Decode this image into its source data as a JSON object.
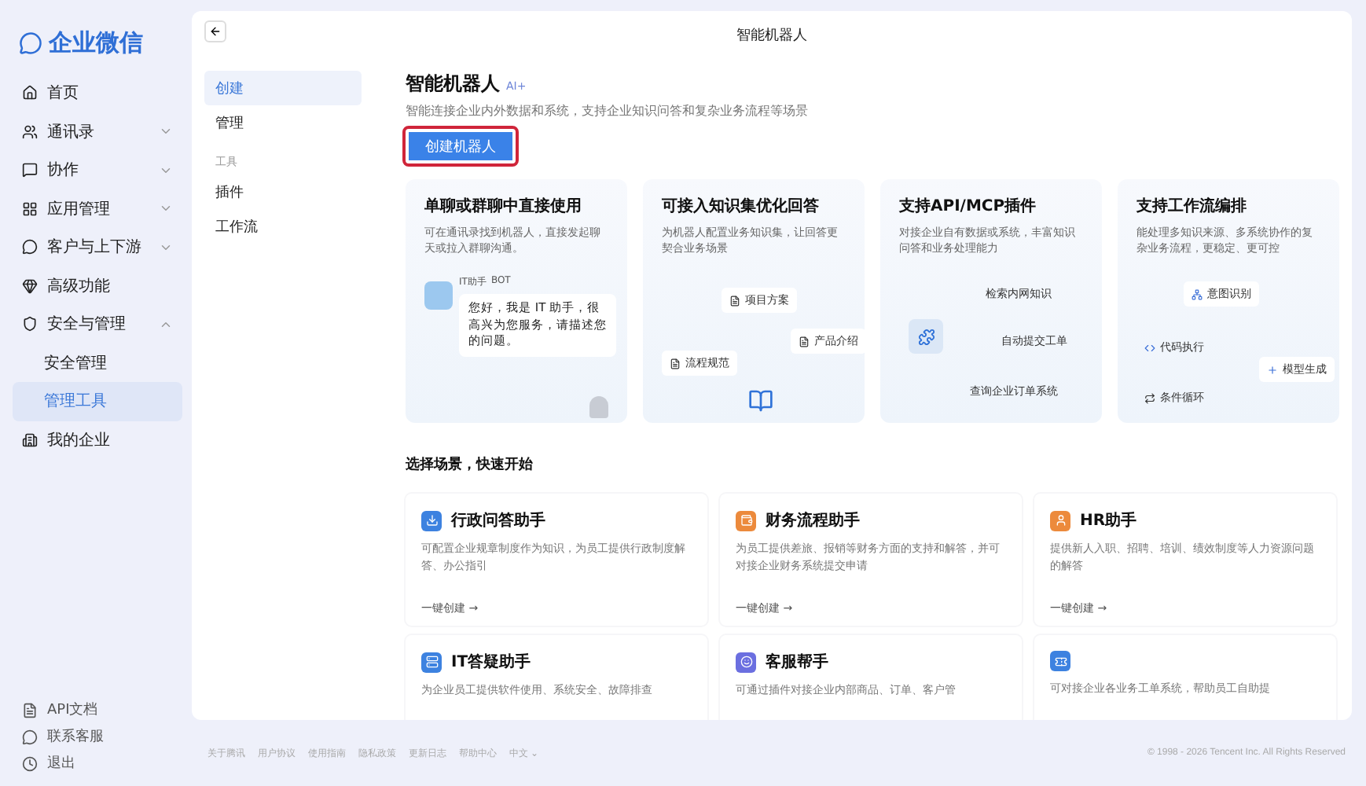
{
  "brand": {
    "name": "企业微信"
  },
  "sidebar": {
    "items": [
      {
        "label": "首页",
        "selected": false
      },
      {
        "label": "通讯录",
        "expanded": false,
        "selected": false
      },
      {
        "label": "协作",
        "expanded": false,
        "selected": false
      },
      {
        "label": "应用管理",
        "expanded": false,
        "selected": false
      },
      {
        "label": "客户与上下游",
        "expanded": false,
        "selected": false
      },
      {
        "label": "高级功能",
        "selected": false
      },
      {
        "label": "安全与管理",
        "expanded": true,
        "selected": false,
        "children": [
          {
            "label": "安全管理",
            "selected": false
          },
          {
            "label": "管理工具",
            "selected": true
          }
        ]
      },
      {
        "label": "我的企业",
        "selected": false
      }
    ],
    "bottom_links": [
      {
        "label": "API文档"
      },
      {
        "label": "联系客服"
      },
      {
        "label": "退出"
      }
    ]
  },
  "header": {
    "title": "智能机器人"
  },
  "subnav": [
    {
      "kind": "item",
      "label": "创建",
      "selected": true
    },
    {
      "kind": "item",
      "label": "管理",
      "selected": false
    },
    {
      "kind": "group",
      "label": "工具"
    },
    {
      "kind": "item",
      "label": "插件",
      "selected": false
    },
    {
      "kind": "item",
      "label": "工作流",
      "selected": false
    }
  ],
  "intro": {
    "title": "智能机器人",
    "badge": "AI+",
    "description": "智能连接企业内外数据和系统，支持企业知识问答和复杂业务流程等场景",
    "button": "创建机器人"
  },
  "features": [
    {
      "kind": "chat",
      "title": "单聊或群聊中直接使用",
      "description": "可在通讯录找到机器人，直接发起聊天或拉入群聊沟通。",
      "bot_name": "IT助手",
      "bot_tag": "BOT",
      "message": "您好，我是 IT 助手，很高兴为您服务，请描述您的问题。"
    },
    {
      "kind": "knowledge",
      "title": "可接入知识集优化回答",
      "description": "为机器人配置业务知识集，让回答更契合业务场景",
      "chips": [
        "项目方案",
        "产品介绍",
        "流程规范"
      ]
    },
    {
      "kind": "plugin",
      "title": "支持API/MCP插件",
      "description": "对接企业自有数据或系统，丰富知识问答和业务处理能力",
      "chips": [
        "检索内网知识",
        "自动提交工单",
        "查询企业订单系统"
      ]
    },
    {
      "kind": "workflow",
      "title": "支持工作流编排",
      "description": "能处理多知识来源、多系统协作的复杂业务流程，更稳定、更可控",
      "chips": [
        "意图识别",
        "代码执行",
        "模型生成",
        "条件循环"
      ]
    }
  ],
  "scenarios": {
    "title": "选择场景，快速开始",
    "cards": [
      {
        "title": "行政问答助手",
        "color": "#3d82e0",
        "description": "可配置企业规章制度作为知识，为员工提供行政制度解答、办公指引",
        "action": "一键创建 →"
      },
      {
        "title": "财务流程助手",
        "color": "#ec8a3c",
        "description": "为员工提供差旅、报销等财务方面的支持和解答，并可对接企业财务系统提交申请",
        "action": "一键创建 →"
      },
      {
        "title": "HR助手",
        "color": "#ec8a3c",
        "description": "提供新人入职、招聘、培训、绩效制度等人力资源问题的解答",
        "action": "一键创建 →"
      },
      {
        "title": "IT答疑助手",
        "color": "#3d82e0",
        "description": "为企业员工提供软件使用、系统安全、故障排查"
      },
      {
        "title": "客服帮手",
        "color": "#6b6fe0",
        "description": "可通过插件对接企业内部商品、订单、客户管"
      },
      {
        "color": "#3d82e0",
        "description": "可对接企业各业务工单系统，帮助员工自助提"
      }
    ]
  },
  "footer": {
    "links": [
      "关于腾讯",
      "用户协议",
      "使用指南",
      "隐私政策",
      "更新日志",
      "帮助中心",
      "中文 ⌄"
    ],
    "copyright": "© 1998 - 2026 Tencent Inc. All Rights Reserved"
  }
}
